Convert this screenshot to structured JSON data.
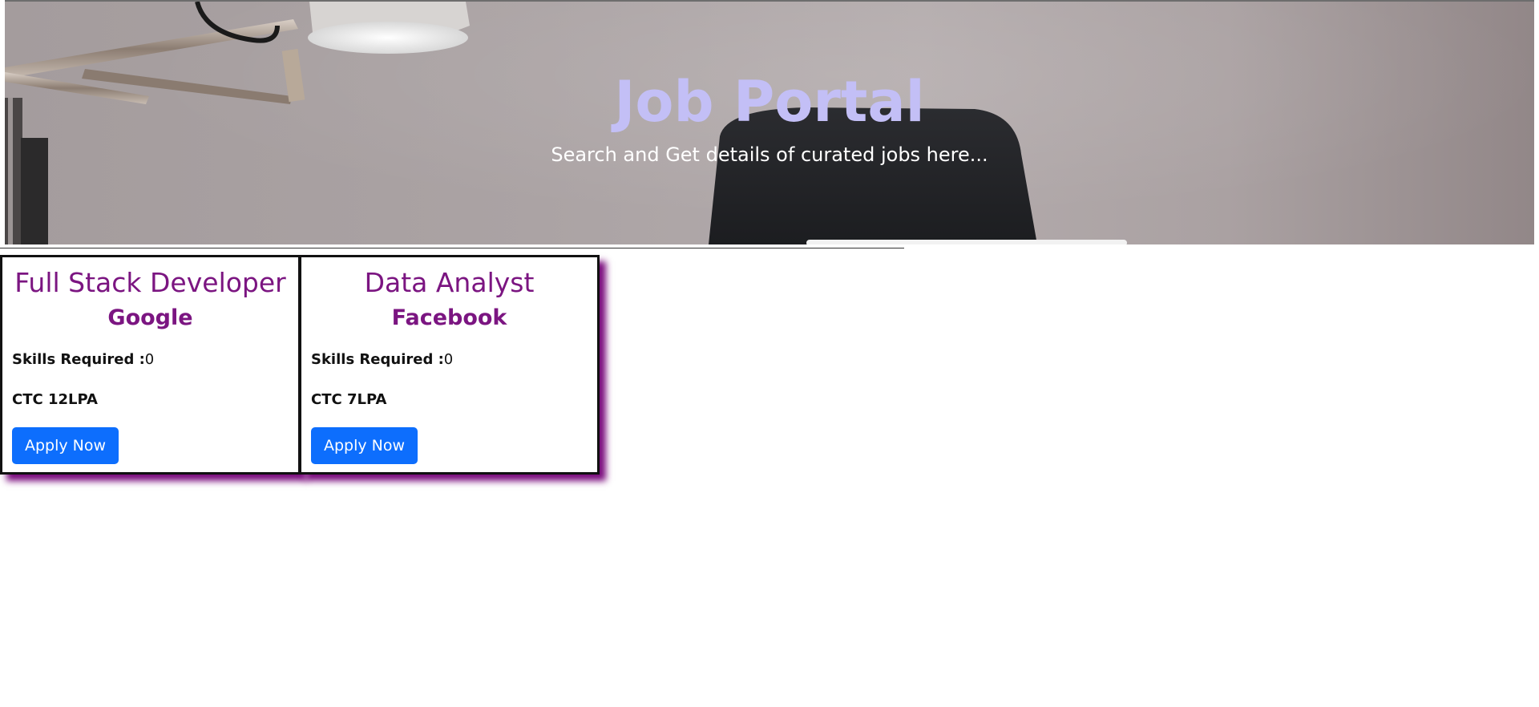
{
  "hero": {
    "title": "Job Portal",
    "subtitle": "Search and Get details of curated jobs here..."
  },
  "colors": {
    "title": "#c3bff6",
    "card_heading": "#7b1581",
    "card_shadow": "#7a0b7d",
    "button": "#0d6efd"
  },
  "jobs": [
    {
      "title": "Full Stack Developer",
      "company": "Google",
      "skills_label": "Skills Required :",
      "skills_value": "0",
      "ctc": "CTC 12LPA",
      "apply_label": "Apply Now"
    },
    {
      "title": "Data Analyst",
      "company": "Facebook",
      "skills_label": "Skills Required :",
      "skills_value": "0",
      "ctc": "CTC 7LPA",
      "apply_label": "Apply Now"
    }
  ]
}
